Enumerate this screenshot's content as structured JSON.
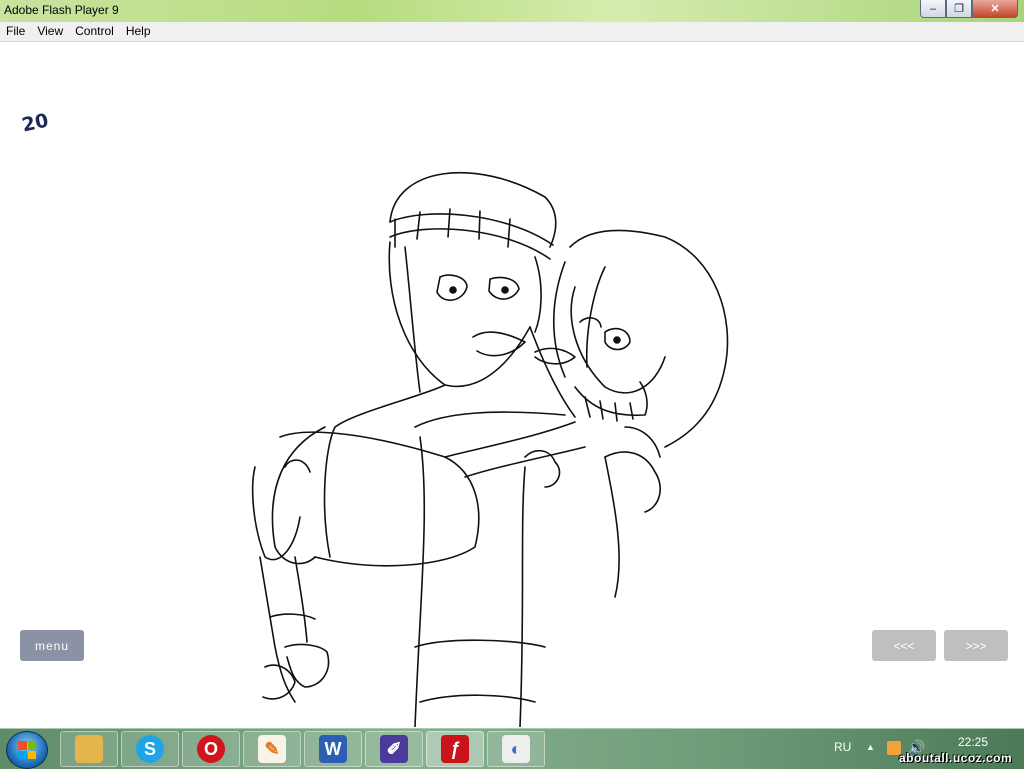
{
  "window": {
    "title": "Adobe Flash Player 9",
    "controls": {
      "minimize": "–",
      "maximize": "❐",
      "close": "✕"
    }
  },
  "menubar": {
    "items": [
      "File",
      "View",
      "Control",
      "Help"
    ]
  },
  "stage": {
    "page_number": "20",
    "menu_button": "menu",
    "prev_button": "<<<",
    "next_button": ">>>"
  },
  "taskbar": {
    "apps": [
      {
        "name": "explorer",
        "icon": "folder-icon",
        "glyph": "",
        "color": "#e3b54a"
      },
      {
        "name": "skype",
        "icon": "skype-icon",
        "glyph": "S",
        "color": "#1fa4e5"
      },
      {
        "name": "opera",
        "icon": "opera-icon",
        "glyph": "O",
        "color": "#d0161c"
      },
      {
        "name": "paint-tool",
        "icon": "pen-tablet-icon",
        "glyph": "✎",
        "color": "#f7f3e6"
      },
      {
        "name": "word",
        "icon": "word-icon",
        "glyph": "W",
        "color": "#2b5fb3"
      },
      {
        "name": "editor",
        "icon": "pencil-app-icon",
        "glyph": "✐",
        "color": "#4a3a9a"
      },
      {
        "name": "flash-player",
        "icon": "flash-icon",
        "glyph": "ƒ",
        "color": "#c8141a",
        "active": true
      },
      {
        "name": "paint",
        "icon": "palette-icon",
        "glyph": "◐",
        "color": "#eeeeee"
      }
    ],
    "tray": {
      "language": "RU",
      "clock": "22:25",
      "watermark": "aboutall.ucoz.com"
    }
  }
}
